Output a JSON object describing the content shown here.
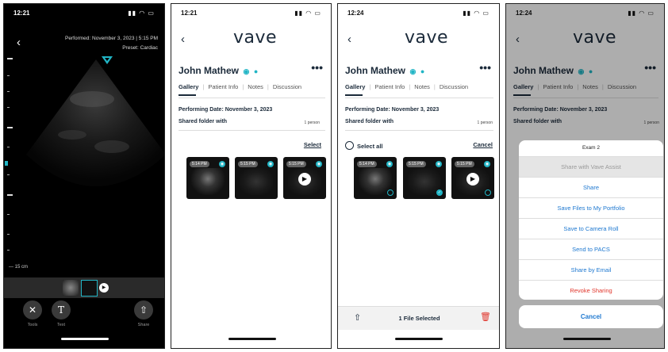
{
  "ultrasound": {
    "time": "12:21",
    "performed": "Performed: November 3, 2023 | 5:15 PM",
    "preset": "Preset: Cardiac",
    "depth": "15 cm",
    "tools": [
      {
        "label": "Tools",
        "icon": "tools-icon"
      },
      {
        "label": "Text",
        "icon": "text-icon"
      },
      {
        "label": "Share",
        "icon": "share-icon"
      }
    ]
  },
  "gallery": {
    "time": "12:21",
    "logo": "vave",
    "patient": "John Mathew",
    "tabs": [
      "Gallery",
      "Patient Info",
      "Notes",
      "Discussion"
    ],
    "performing_date": "Performing Date: November 3, 2023",
    "shared_folder": "Shared folder with",
    "person_count": "1 person",
    "select": "Select",
    "thumbs": [
      "5:14 PM",
      "5:15 PM",
      "5:15 PM"
    ]
  },
  "selection": {
    "time": "12:24",
    "logo": "vave",
    "patient": "John Mathew",
    "tabs": [
      "Gallery",
      "Patient Info",
      "Notes",
      "Discussion"
    ],
    "performing_date": "Performing Date: November 3, 2023",
    "shared_folder": "Shared folder with",
    "person_count": "1 person",
    "select_all": "Select all",
    "cancel": "Cancel",
    "thumbs": [
      "5:14 PM",
      "5:15 PM",
      "5:15 PM"
    ],
    "selected_label": "1 File Selected"
  },
  "share_sheet": {
    "time": "12:24",
    "logo": "vave",
    "patient": "John Mathew",
    "tabs": [
      "Gallery",
      "Patient Info",
      "Notes",
      "Discussion"
    ],
    "performing_date": "Performing Date: November 3, 2023",
    "shared_folder": "Shared folder with",
    "person_count": "1 person",
    "title": "Exam 2",
    "items": {
      "assist": "Share with Vave Assist",
      "share": "Share",
      "portfolio": "Save Files to My Portfolio",
      "camera_roll": "Save to Camera Roll",
      "pacs": "Send to PACS",
      "email": "Share by Email",
      "revoke": "Revoke Sharing"
    },
    "cancel": "Cancel"
  },
  "colors": {
    "navy": "#1b2a3a",
    "teal": "#21b5c5",
    "ios_blue": "#1e78d0",
    "red": "#e0352b"
  }
}
